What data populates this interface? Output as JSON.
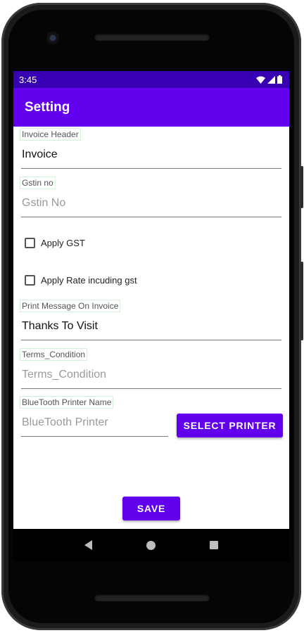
{
  "status_bar": {
    "time": "3:45",
    "icons": [
      "wifi-icon",
      "signal-icon",
      "battery-icon"
    ]
  },
  "app_bar": {
    "title": "Setting"
  },
  "form": {
    "invoice_header": {
      "label": "Invoice Header",
      "value": "Invoice"
    },
    "gstin": {
      "label": "Gstin no",
      "placeholder": "Gstin No"
    },
    "apply_gst": {
      "label": "Apply GST",
      "checked": false
    },
    "apply_rate_including_gst": {
      "label": "Apply Rate incuding gst",
      "checked": false
    },
    "print_message": {
      "label": "Print Message On Invoice",
      "value": "Thanks To Visit"
    },
    "terms": {
      "label": "Terms_Condition",
      "placeholder": "Terms_Condition"
    },
    "bluetooth_printer": {
      "label": "BlueTooth Printer Name",
      "placeholder": "BlueTooth Printer"
    }
  },
  "buttons": {
    "select_printer": "SELECT PRINTER",
    "save": "SAVE"
  },
  "nav_bar": {
    "icons": [
      "back-icon",
      "home-icon",
      "recents-icon"
    ]
  },
  "colors": {
    "status_bar": "#3700b3",
    "primary": "#6200ee"
  }
}
